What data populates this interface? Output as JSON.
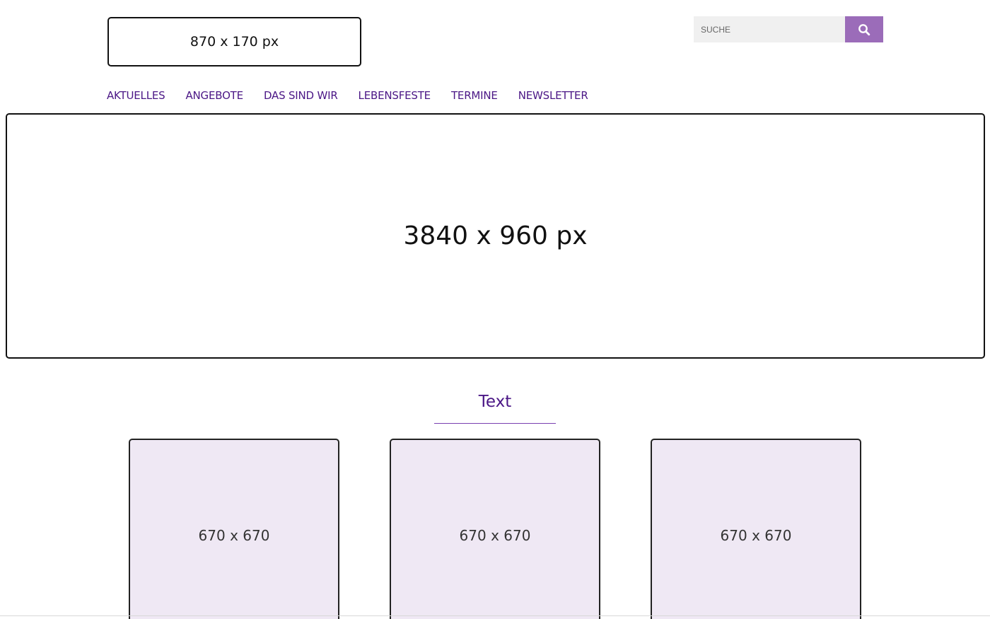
{
  "header": {
    "logo_placeholder": "870 x 170 px"
  },
  "search": {
    "placeholder": "SUCHE",
    "icon": "search-icon",
    "button_color": "#9b6cb9"
  },
  "nav": {
    "items": [
      {
        "label": "AKTUELLES"
      },
      {
        "label": "ANGEBOTE"
      },
      {
        "label": "DAS SIND WIR"
      },
      {
        "label": "LEBENSFESTE"
      },
      {
        "label": "TERMINE"
      },
      {
        "label": "NEWSLETTER"
      }
    ],
    "color": "#4b1786"
  },
  "hero": {
    "placeholder": "3840 x 960 px"
  },
  "section": {
    "title": "Text"
  },
  "cards": [
    {
      "label": "670 x 670"
    },
    {
      "label": "670 x 670"
    },
    {
      "label": "670 x 670"
    }
  ]
}
